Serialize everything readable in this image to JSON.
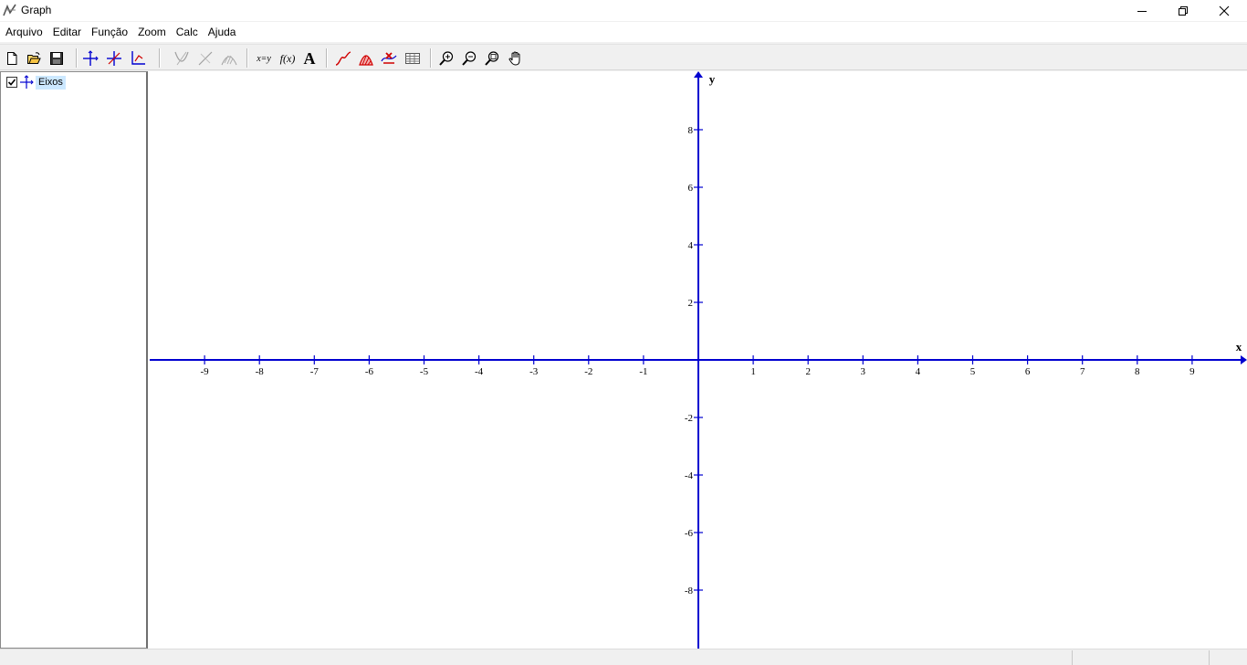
{
  "window": {
    "title": "Graph",
    "controls": {
      "minimize": "minimize-icon",
      "restore": "restore-icon",
      "close": "close-icon"
    }
  },
  "menu": {
    "items": [
      "Arquivo",
      "Editar",
      "Função",
      "Zoom",
      "Calc",
      "Ajuda"
    ]
  },
  "toolbar": {
    "groups": [
      [
        "new-file-icon",
        "open-folder-icon",
        "save-icon"
      ],
      [
        "axes-icon",
        "cross-axes-icon",
        "axes-custom-icon"
      ],
      [
        "tangent-icon",
        "normal-icon",
        "shading-icon"
      ],
      [
        "point-series-icon",
        "fx-icon",
        "text-label-icon"
      ],
      [
        "insert-function-icon",
        "insert-shading-icon",
        "insert-point-icon",
        "table-icon"
      ],
      [
        "zoom-in-icon",
        "zoom-out-icon",
        "zoom-fit-icon",
        "pan-hand-icon"
      ]
    ],
    "labels": {
      "xy": "x=y",
      "fx": "f(x)",
      "text": "A"
    }
  },
  "tree": {
    "items": [
      {
        "label": "Eixos",
        "checked": true,
        "icon": "axes-icon"
      }
    ]
  },
  "colors": {
    "axis": "#0000d0",
    "tree_highlight": "#cce8ff"
  },
  "chart_data": {
    "type": "line",
    "series": [],
    "xlim": [
      -10,
      10
    ],
    "ylim": [
      -10,
      10
    ],
    "xlabel": "x",
    "ylabel": "y",
    "x_ticks": [
      -9,
      -8,
      -7,
      -6,
      -5,
      -4,
      -3,
      -2,
      -1,
      1,
      2,
      3,
      4,
      5,
      6,
      7,
      8,
      9
    ],
    "y_ticks": [
      -8,
      -6,
      -4,
      -2,
      2,
      4,
      6,
      8
    ],
    "x_tick_labels": [
      "-9",
      "-8",
      "-7",
      "-6",
      "-5",
      "-4",
      "-3",
      "-2",
      "-1",
      "1",
      "2",
      "3",
      "4",
      "5",
      "6",
      "7",
      "8",
      "9"
    ],
    "y_tick_labels": [
      "-8",
      "-6",
      "-4",
      "-2",
      "2",
      "4",
      "6",
      "8"
    ],
    "grid": false
  }
}
